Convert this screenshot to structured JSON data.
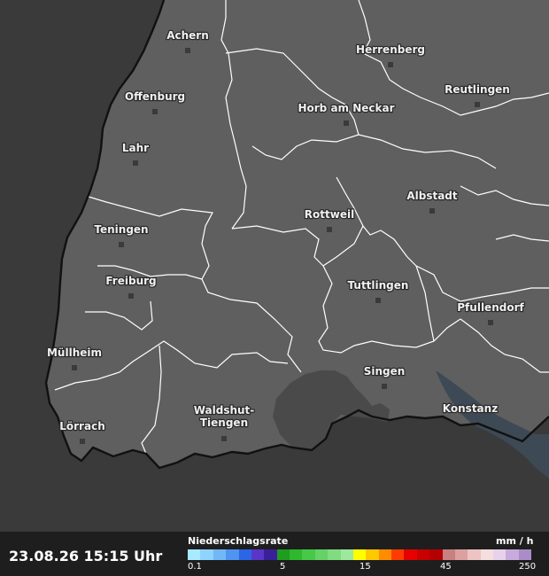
{
  "map": {
    "colors": {
      "land": "#5f5f5f",
      "outside": "#3a3a3a",
      "highlight_region": "#4a4a4a",
      "water": "#3d4a55",
      "borders": "#ffffff",
      "national_border": "#111111"
    },
    "cities": [
      {
        "name": "Achern"
      },
      {
        "name": "Herrenberg"
      },
      {
        "name": "Offenburg"
      },
      {
        "name": "Reutlingen"
      },
      {
        "name": "Horb am Neckar"
      },
      {
        "name": "Lahr"
      },
      {
        "name": "Albstadt"
      },
      {
        "name": "Rottweil"
      },
      {
        "name": "Teningen"
      },
      {
        "name": "Freiburg"
      },
      {
        "name": "Tuttlingen"
      },
      {
        "name": "Pfullendorf"
      },
      {
        "name": "Müllheim"
      },
      {
        "name": "Singen"
      },
      {
        "name": "Waldshut-Tiengen"
      },
      {
        "name": "Konstanz"
      },
      {
        "name": "Lörrach"
      }
    ]
  },
  "footer": {
    "timestamp": "23.08.26 15:15 Uhr",
    "legend_title": "Niederschlagsrate",
    "legend_unit": "mm / h",
    "ticks": [
      "0.1",
      "5",
      "15",
      "45",
      "250"
    ],
    "colors": [
      "#a8eaff",
      "#8fd3ff",
      "#72b8f7",
      "#4f94f0",
      "#2a66e6",
      "#5a35c9",
      "#3a1f9a",
      "#1e9d1e",
      "#2eb82e",
      "#48c848",
      "#64d264",
      "#80dc80",
      "#9ce89c",
      "#ffff00",
      "#ffc800",
      "#ff8c00",
      "#ff3c00",
      "#e60000",
      "#c80000",
      "#b40000",
      "#c88080",
      "#dca0a0",
      "#ecc4c4",
      "#f5dede",
      "#e6d2ec",
      "#c8aadc",
      "#aa8cc8"
    ]
  }
}
